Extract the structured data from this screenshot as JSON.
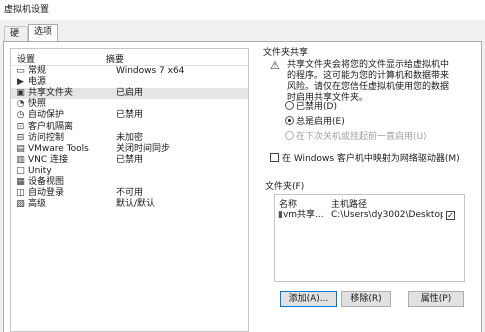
{
  "window": {
    "title": "虚拟机设置"
  },
  "tabs": [
    {
      "label": "硬件",
      "active": false
    },
    {
      "label": "选项",
      "active": true
    }
  ],
  "device_list": {
    "header_setting": "设置",
    "header_summary": "摘要",
    "items": [
      {
        "name": "常规",
        "summary": "Windows 7 x64",
        "icon": "general-icon",
        "glyph": "▭",
        "selected": false
      },
      {
        "name": "电源",
        "summary": "",
        "icon": "power-icon",
        "glyph": "▶",
        "selected": false
      },
      {
        "name": "共享文件夹",
        "summary": "已启用",
        "icon": "shared-folder-icon",
        "glyph": "▣",
        "selected": true
      },
      {
        "name": "快照",
        "summary": "",
        "icon": "snapshot-icon",
        "glyph": "◔",
        "selected": false
      },
      {
        "name": "自动保护",
        "summary": "已禁用",
        "icon": "autoprotect-icon",
        "glyph": "◷",
        "selected": false
      },
      {
        "name": "客户机隔离",
        "summary": "",
        "icon": "isolation-icon",
        "glyph": "⊡",
        "selected": false
      },
      {
        "name": "访问控制",
        "summary": "未加密",
        "icon": "access-control-icon",
        "glyph": "⊟",
        "selected": false
      },
      {
        "name": "VMware Tools",
        "summary": "关闭时间同步",
        "icon": "vmware-tools-icon",
        "glyph": "▤",
        "selected": false
      },
      {
        "name": "VNC 连接",
        "summary": "已禁用",
        "icon": "vnc-icon",
        "glyph": "▥",
        "selected": false
      },
      {
        "name": "Unity",
        "summary": "",
        "icon": "unity-icon",
        "glyph": "□",
        "selected": false
      },
      {
        "name": "设备视图",
        "summary": "",
        "icon": "device-view-icon",
        "glyph": "▦",
        "selected": false
      },
      {
        "name": "自动登录",
        "summary": "不可用",
        "icon": "autologin-icon",
        "glyph": "◫",
        "selected": false
      },
      {
        "name": "高级",
        "summary": "默认/默认",
        "icon": "advanced-icon",
        "glyph": "▧",
        "selected": false
      }
    ]
  },
  "sharing": {
    "group_title": "文件夹共享",
    "info_lines": [
      "共享文件夹会将您的文件显示给虚拟机中",
      "的程序。这可能为您的计算机和数据带来",
      "风险。请仅在您信任虚拟机使用您的数据",
      "时启用共享文件夹。"
    ],
    "options": [
      {
        "label": "已禁用(D)",
        "selected": false,
        "disabled": false
      },
      {
        "label": "总是启用(E)",
        "selected": true,
        "disabled": false
      },
      {
        "label": "在下次关机或挂起前一直启用(U)",
        "selected": false,
        "disabled": true
      }
    ],
    "map_drive_label": "在 Windows 客户机中映射为网络驱动器(M)"
  },
  "folders": {
    "group_title": "文件夹(F)",
    "col_name": "名称",
    "col_path": "主机路径",
    "rows": [
      {
        "name": "vm共享...",
        "path": "C:\\Users\\dy3002\\Desktop...",
        "enabled": true
      }
    ],
    "buttons": {
      "add": "添加(A)...",
      "remove": "移除(R)",
      "properties": "属性(P)"
    }
  }
}
